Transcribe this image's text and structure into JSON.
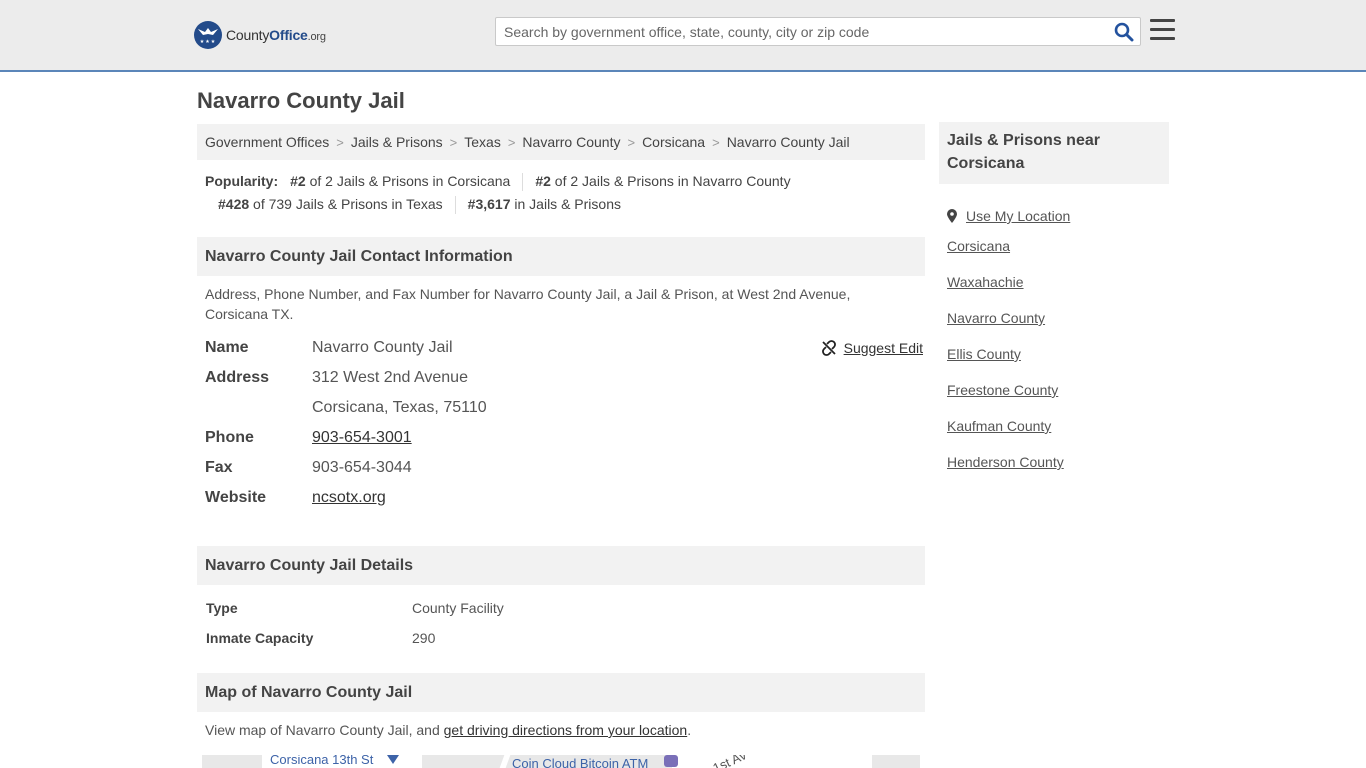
{
  "header": {
    "logo_prefix": "County",
    "logo_brand": "Office",
    "logo_tld": ".org",
    "search_placeholder": "Search by government office, state, county, city or zip code"
  },
  "page": {
    "title": "Navarro County Jail"
  },
  "breadcrumb": [
    "Government Offices",
    "Jails & Prisons",
    "Texas",
    "Navarro County",
    "Corsicana",
    "Navarro County Jail"
  ],
  "popularity": {
    "label": "Popularity:",
    "items": [
      {
        "rank": "#2",
        "text": " of 2 Jails & Prisons in Corsicana"
      },
      {
        "rank": "#2",
        "text": " of 2 Jails & Prisons in Navarro County"
      },
      {
        "rank": "#428",
        "text": " of 739 Jails & Prisons in Texas"
      },
      {
        "rank": "#3,617",
        "text": " in Jails & Prisons"
      }
    ]
  },
  "contact": {
    "heading": "Navarro County Jail Contact Information",
    "description": "Address, Phone Number, and Fax Number for Navarro County Jail, a Jail & Prison, at West 2nd Avenue, Corsicana TX.",
    "suggest_edit": "Suggest Edit",
    "name_label": "Name",
    "name": "Navarro County Jail",
    "address_label": "Address",
    "address_line1": "312 West 2nd Avenue",
    "address_line2": "Corsicana, Texas, 75110",
    "phone_label": "Phone",
    "phone": "903-654-3001",
    "fax_label": "Fax",
    "fax": "903-654-3044",
    "website_label": "Website",
    "website": "ncsotx.org"
  },
  "details": {
    "heading": "Navarro County Jail Details",
    "rows": [
      {
        "label": "Type",
        "value": "County Facility"
      },
      {
        "label": "Inmate Capacity",
        "value": "290"
      }
    ]
  },
  "map_section": {
    "heading": "Map of Navarro County Jail",
    "desc_prefix": "View map of Navarro County Jail, and ",
    "desc_link": "get driving directions from your location",
    "desc_suffix": ".",
    "map_labels": [
      "Corsicana 13th St",
      "Coin Cloud Bitcoin ATM",
      "1st Av"
    ]
  },
  "sidebar": {
    "heading": "Jails & Prisons near Corsicana",
    "use_location": "Use My Location",
    "links": [
      "Corsicana",
      "Waxahachie",
      "Navarro County",
      "Ellis County",
      "Freestone County",
      "Kaufman County",
      "Henderson County"
    ]
  }
}
